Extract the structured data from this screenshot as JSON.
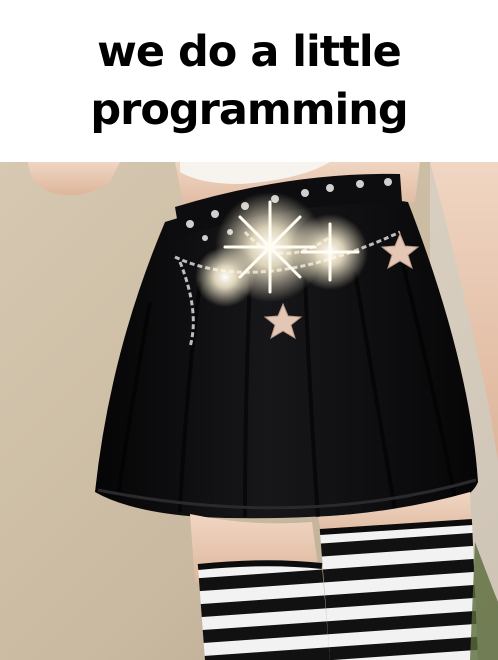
{
  "caption": {
    "line1": "we do a little",
    "line2": "programming"
  },
  "photo": {
    "icon": "skirt-photo-image",
    "colors": {
      "wall": "#cdbea7",
      "skin": "#e9c9b1",
      "skirt": "#0b0b0d",
      "stripe_light": "#f2f2f2",
      "stripe_dark": "#121212",
      "sparkle": "#fff8e0"
    }
  }
}
